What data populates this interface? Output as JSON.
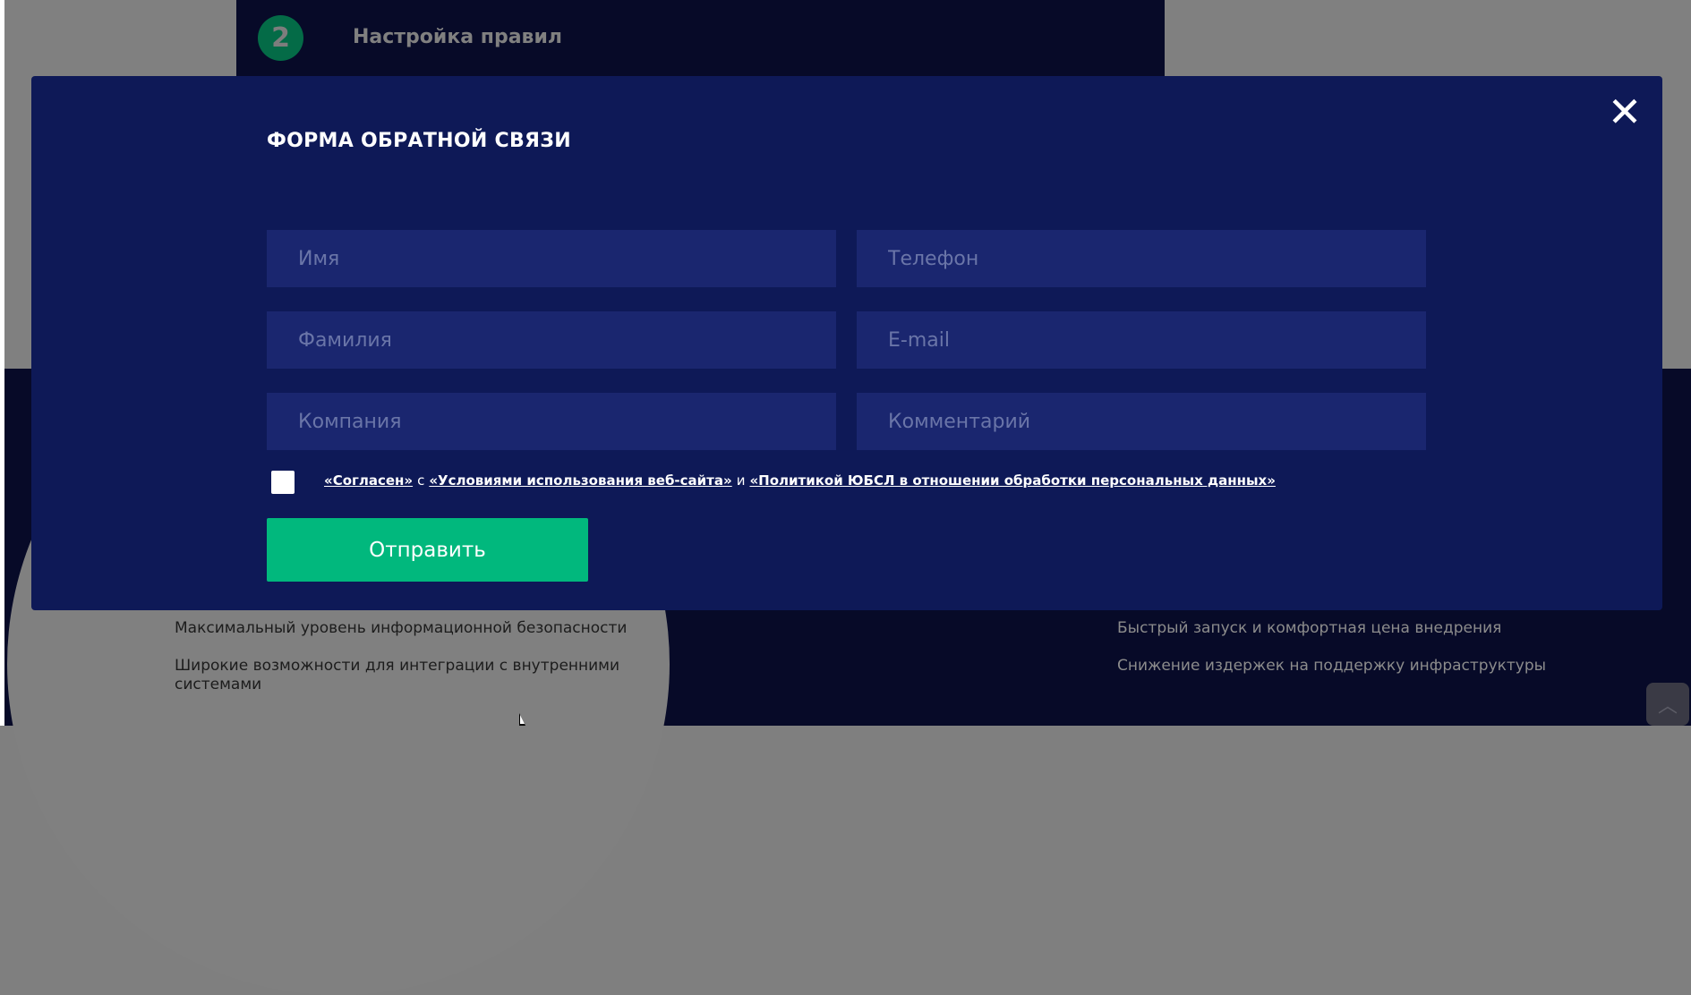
{
  "background": {
    "step_number": "2",
    "step_title": "Настройка правил",
    "features_left": [
      "Максимальный уровень информационной безопасности",
      "Широкие возможности для интеграции с внутренними системами"
    ],
    "features_right": [
      "Быстрый запуск и комфортная цена внедрения",
      "Снижение издержек на поддержку инфраструктуры"
    ],
    "scroll_top_icon": "chevron-up-icon"
  },
  "modal": {
    "close_symbol": "✕",
    "title": "ФОРМА ОБРАТНОЙ СВЯЗИ",
    "fields": {
      "first_name": {
        "placeholder": "Имя",
        "value": ""
      },
      "phone": {
        "placeholder": "Телефон",
        "value": ""
      },
      "last_name": {
        "placeholder": "Фамилия",
        "value": ""
      },
      "email": {
        "placeholder": "E-mail",
        "value": ""
      },
      "company": {
        "placeholder": "Компания",
        "value": ""
      },
      "comment": {
        "placeholder": "Комментарий",
        "value": ""
      }
    },
    "consent": {
      "agree_link": "«Согласен»",
      "with": "с",
      "terms_link": "«Условиями использования веб-сайта»",
      "and": "и",
      "policy_link": "«Политикой ЮБСЛ в отношении обработки персональных данных»"
    },
    "submit_label": "Отправить"
  },
  "colors": {
    "modal_bg": "#0e1957",
    "field_bg": "#1a266f",
    "accent_green": "#01b87d",
    "page_dark": "#070a28"
  }
}
